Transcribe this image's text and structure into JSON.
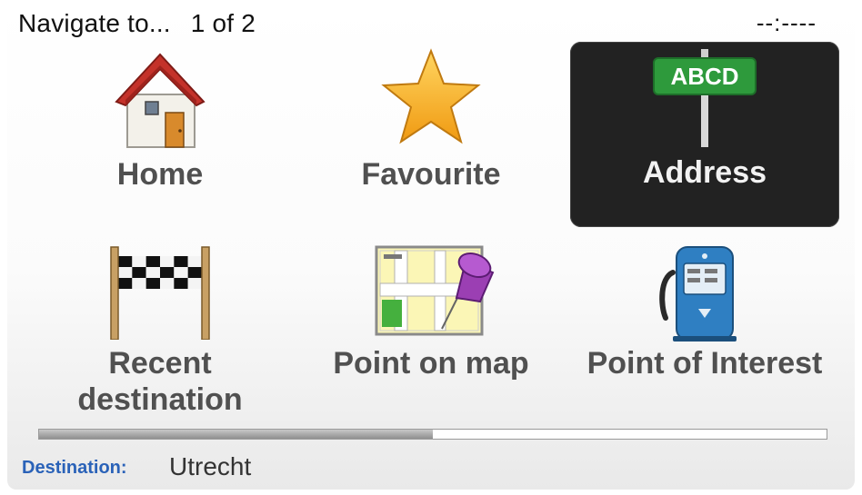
{
  "header": {
    "title": "Navigate to...",
    "page": "1 of 2",
    "time": "--:----"
  },
  "tiles": [
    {
      "label": "Home",
      "icon": "house-icon"
    },
    {
      "label": "Favourite",
      "icon": "star-icon"
    },
    {
      "label": "Address",
      "icon": "street-sign-icon",
      "sign_text": "ABCD",
      "selected": true
    },
    {
      "label": "Recent destination",
      "icon": "checkered-flag-icon"
    },
    {
      "label": "Point on map",
      "icon": "map-pin-icon"
    },
    {
      "label": "Point of Interest",
      "icon": "fuel-pump-icon"
    }
  ],
  "page_progress": 0.5,
  "footer": {
    "destination_label": "Destination:",
    "destination_value": "Utrecht"
  },
  "colors": {
    "selected_tile": "#222222",
    "label_gray": "#505050",
    "destination_blue": "#2a62b8",
    "sign_green": "#2e9a3c"
  }
}
